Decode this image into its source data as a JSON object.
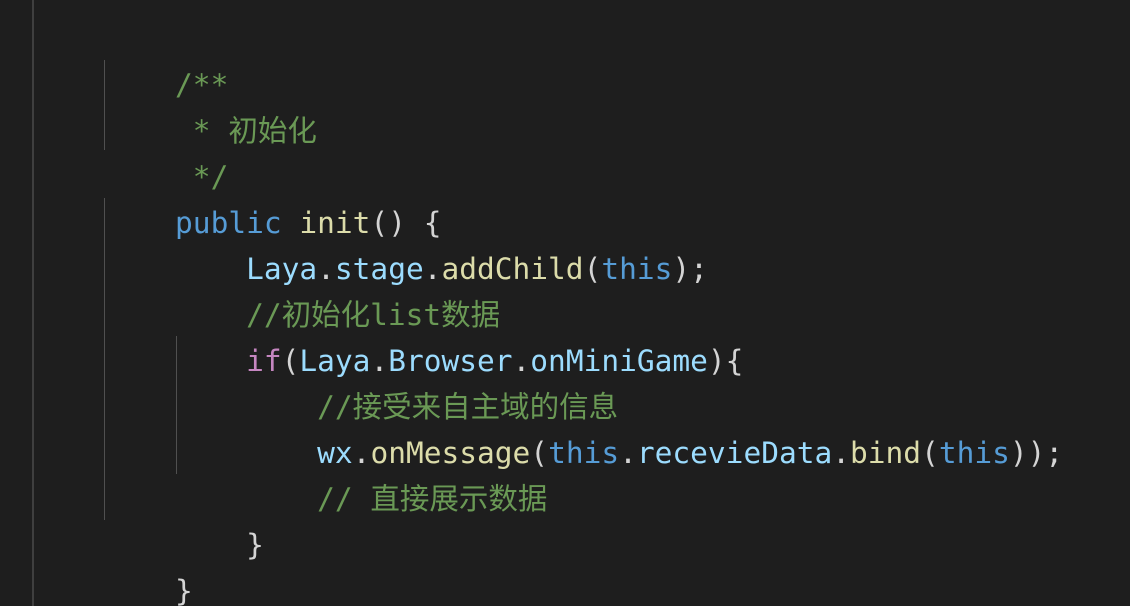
{
  "code": {
    "doc_open": "/**",
    "doc_star_line": " * 初始化",
    "doc_close": " */",
    "l4_kw": "public",
    "l4_sp": " ",
    "l4_fn": "init",
    "l4_rest": "() {",
    "l5_indent": "    ",
    "l5_obj": "Laya",
    "l5_dot1": ".",
    "l5_prop": "stage",
    "l5_dot2": ".",
    "l5_fn": "addChild",
    "l5_paren": "(",
    "l5_this": "this",
    "l5_end": ");",
    "l6_indent": "    ",
    "l6_comment": "//初始化list数据",
    "l7_indent": "    ",
    "l7_if": "if",
    "l7_paren": "(",
    "l7_obj": "Laya",
    "l7_dot1": ".",
    "l7_prop1": "Browser",
    "l7_dot2": ".",
    "l7_prop2": "onMiniGame",
    "l7_end": "){",
    "l8_indent": "        ",
    "l8_comment": "//接受来自主域的信息",
    "l9_indent": "        ",
    "l9_obj": "wx",
    "l9_dot1": ".",
    "l9_fn": "onMessage",
    "l9_paren": "(",
    "l9_this1": "this",
    "l9_dot2": ".",
    "l9_prop": "recevieData",
    "l9_dot3": ".",
    "l9_fn2": "bind",
    "l9_paren2": "(",
    "l9_this2": "this",
    "l9_end": "));",
    "l10_indent": "        ",
    "l10_comment": "// 直接展示数据",
    "l11_indent": "    ",
    "l11_brace": "}",
    "l12_brace": "}"
  }
}
